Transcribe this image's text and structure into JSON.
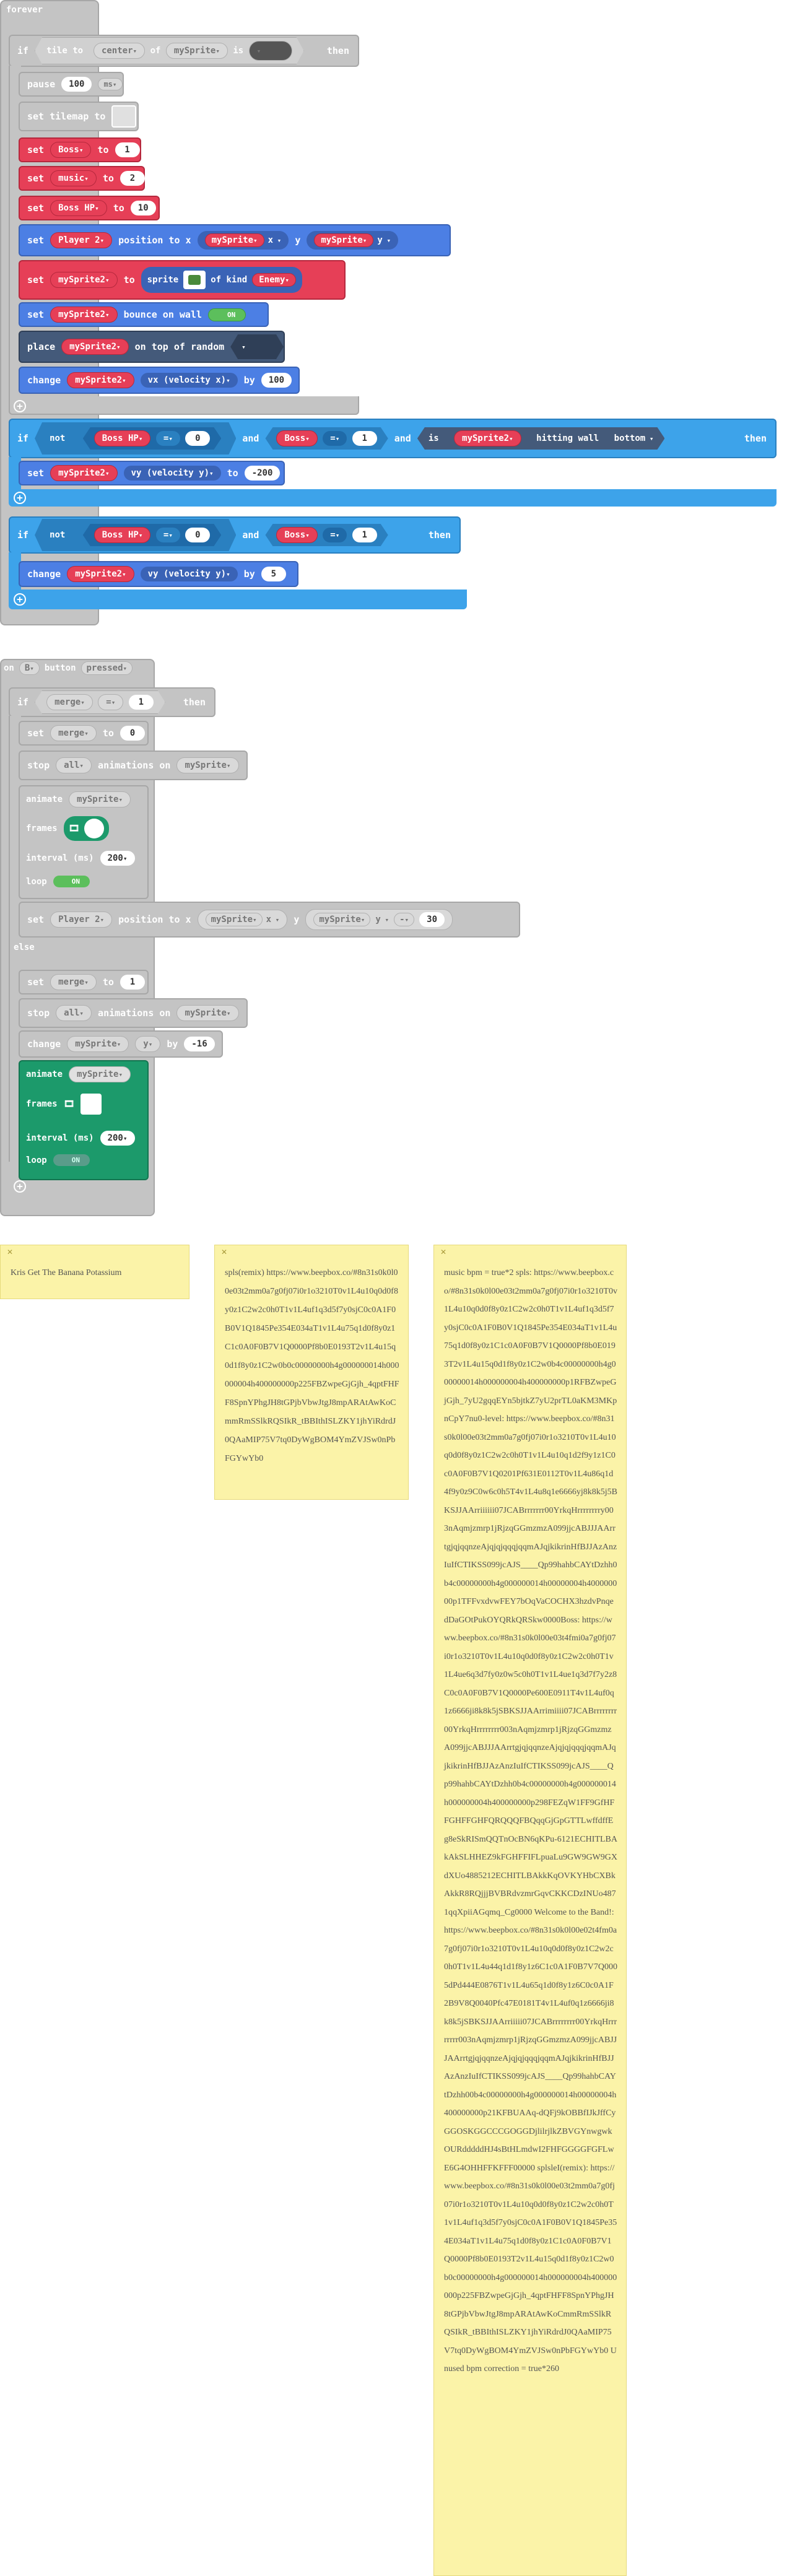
{
  "forever": {
    "label": "forever",
    "if1": {
      "if": "if",
      "tile_to": "tile to",
      "center": "center",
      "of": "of",
      "sprite": "mySprite",
      "is": "is",
      "then": "then"
    },
    "pause": {
      "label": "pause",
      "value": "100",
      "unit": "ms"
    },
    "set_tilemap": {
      "label": "set tilemap to"
    },
    "set_boss": {
      "set": "set",
      "var": "Boss",
      "to": "to",
      "value": "1"
    },
    "set_music": {
      "set": "set",
      "var": "music",
      "to": "to",
      "value": "2"
    },
    "set_bosshp": {
      "set": "set",
      "var": "Boss HP",
      "to": "to",
      "value": "10"
    },
    "set_pos": {
      "set": "set",
      "player": "Player 2",
      "mid": "position to x",
      "sprite": "mySprite",
      "x": "x",
      "y_label": "y",
      "sprite2": "mySprite",
      "y": "y"
    },
    "set_sprite2": {
      "set": "set",
      "var": "mySprite2",
      "to": "to",
      "sprite": "sprite",
      "of_kind": "of kind",
      "kind": "Enemy"
    },
    "bounce": {
      "set": "set",
      "sprite": "mySprite2",
      "label": "bounce on wall",
      "toggle": "ON"
    },
    "place": {
      "label": "place",
      "sprite": "mySprite2",
      "mid": "on top of random"
    },
    "change_vx": {
      "label": "change",
      "sprite": "mySprite2",
      "prop": "vx (velocity x)",
      "by": "by",
      "value": "100"
    },
    "if2": {
      "if": "if",
      "not": "not",
      "bosshp": "Boss HP",
      "eq": "=",
      "zero": "0",
      "and": "and",
      "boss": "Boss",
      "eq2": "=",
      "one": "1",
      "and2": "and",
      "is": "is",
      "sprite": "mySprite2",
      "hitting": "hitting wall",
      "side": "bottom",
      "then": "then"
    },
    "set_vy": {
      "set": "set",
      "sprite": "mySprite2",
      "prop": "vy (velocity y)",
      "to": "to",
      "value": "-200"
    },
    "if3": {
      "if": "if",
      "not": "not",
      "bosshp": "Boss HP",
      "eq": "=",
      "zero": "0",
      "and": "and",
      "boss": "Boss",
      "eq2": "=",
      "one": "1",
      "then": "then"
    },
    "change_vy": {
      "label": "change",
      "sprite": "mySprite2",
      "prop": "vy (velocity y)",
      "by": "by",
      "value": "5"
    }
  },
  "onbutton": {
    "on": "on",
    "btn": "B",
    "button": "button",
    "event": "pressed",
    "if": {
      "if": "if",
      "var": "merge",
      "eq": "=",
      "value": "1",
      "then": "then"
    },
    "set_merge0": {
      "set": "set",
      "var": "merge",
      "to": "to",
      "value": "0"
    },
    "stop": {
      "label": "stop",
      "which": "all",
      "mid": "animations on",
      "sprite": "mySprite"
    },
    "animate": {
      "label": "animate",
      "sprite": "mySprite",
      "frames": "frames",
      "interval": "interval (ms)",
      "interval_value": "200",
      "loop": "loop",
      "loop_value": "ON"
    },
    "set_pos": {
      "set": "set",
      "player": "Player 2",
      "mid": "position to x",
      "sprite": "mySprite",
      "x": "x",
      "y_label": "y",
      "sprite2": "mySprite",
      "y": "y",
      "op": "-",
      "value": "30"
    },
    "else": "else",
    "set_merge1": {
      "set": "set",
      "var": "merge",
      "to": "to",
      "value": "1"
    },
    "stop2": {
      "label": "stop",
      "which": "all",
      "mid": "animations on",
      "sprite": "mySprite"
    },
    "change": {
      "label": "change",
      "sprite": "mySprite",
      "prop": "y",
      "by": "by",
      "value": "-16"
    },
    "animate2": {
      "label": "animate",
      "sprite": "mySprite",
      "frames": "frames",
      "interval": "interval (ms)",
      "interval_value": "200",
      "loop": "loop",
      "loop_value": "ON"
    }
  },
  "comments": [
    {
      "text": "Kris Get The Banana Potassium"
    },
    {
      "text": "spls(remix) https://www.beepbox.co/#8n31s0k0l00e03t2mm0a7g0fj07i0r1o3210T0v1L4u10q0d0f8y0z1C2w2c0h0T1v1L4uf1q3d5f7y0sjC0c0A1F0B0V1Q1845Pe354E034aT1v1L4u75q1d0f8y0z1C1c0A0F0B7V1Q0000Pf8b0E0193T2v1L4u15q0d1f8y0z1C2w0b0c00000000h4g000000014h000000004h400000000p225FBZwpeGjGjh_4qptFHFF8SpnYPhgJH8tGPjbVbwJtgJ8mpARAtAwKoCmmRmSSlkRQSIkR_tBBIthISLZKY1jhYiRdrdJ0QAaMIP75V7tq0DyWgBOM4YmZVJSw0nPbFGYwYb0"
    },
    {
      "text": "music bpm = true*2 spls: https://www.beepbox.co/#8n31s0k0l00e03t2mm0a7g0fj07i0r1o3210T0v1L4u10q0d0f8y0z1C2w2c0h0T1v1L4uf1q3d5f7y0sjC0c0A1F0B0V1Q1845Pe354E034aT1v1L4u75q1d0f8y0z1C1c0A0F0B7V1Q0000Pf8b0E0193T2v1L4u15q0d1f8y0z1C2w0b4c00000000h4g000000014h000000004h400000000p1RFBZwpeGjGjh_7yU2gqqEYn5bjtkZ7yU2prTL0aKM3MKpnCpY7nu0-level: https://www.beepbox.co/#8n31s0k0l00e03t2mm0a7g0fj07i0r1o3210T0v1L4u10q0d0f8y0z1C2w2c0h0T1v1L4u10q1d2f9y1z1C0c0A0F0B7V1Q0201Pf631E0112T0v1L4u86q1d4f9y0z9C0w6c0h5T4v1L4u8q1e6666yj8k8k5j5BKSJJAArriiiiii07JCABrrrrrrr00YrkqHrrrrrrrry003nAqmjzmrp1jRjzqGGmzmzA099jjcABJJJAArrtgjqjqqnzeAjqjqjqqqjqqmAJqjkikrinHfBJJAzAnzIuIfCTIKSS099jcAJS____Qp99hahbCAYtDzhh0b4c00000000h4g000000014h00000004h400000000p1TFFvxdvwFEY7bOqVaCOCHX3hzdvPnqedDaGOtPukOYQRkQRSkw0000Boss: https://www.beepbox.co/#8n31s0k0l00e03t4fmi0a7g0fj07i0r1o3210T0v1L4u10q0d0f8y0z1C2w2c0h0T1v1L4ue6q3d7fy0z0w5c0h0T1v1L4ue1q3d7f7y2z8C0c0A0F0B7V1Q0000Pe600E0911T4v1L4uf0q1z6666ji8k8k5jSBKSJJAArrimiiii07JCABrrrrrrrr00YrkqHrrrrrrrr003nAqmjzmrp1jRjzqGGmzmzA099jjcABJJJAArrtgjqjqqnzeAjqjqjqqqjqqmAJqjkikrinHfBJJAzAnzIuIfCTIKSS099jcAJS____Qp99hahbCAYtDzhh0b4c00000000h4g000000014h000000004h400000000p298FEZqW1FF9GfHFFGHFFGHFQRQQQFBQqqGjGpGTTLwffdffEg8eSkRISmQQTnOcBN6qKPu-6121ECHITLBAkAkSLHHEZ9kFGHFFIFLpuaLu9GW9GW9GXdXUo4885212ECHITLBAkkKqOVKYHbCXBkAkkR8RQjjjBVBRdvzmrGqvCKKCDzINUo4871qqXpiiAGqmq_Cg0000 Welcome to the Band!: https://www.beepbox.co/#8n31s0k0l00e02t4fm0a7g0fj07i0r1o3210T0v1L4u10q0d0f8y0z1C2w2c0h0T1v1L4u44q1d1f8y1z6C1c0A1F0B7V7Q0005dPd444E0876T1v1L4u65q1d0f8y1z6C0c0A1F2B9V8Q0040Pfc47E0181T4v1L4uf0q1z6666ji8k8k5jSBKSJJAArriiiii07JCABrrrrrrrr00YrkqHrrrrrrrr003nAqmjzmrp1jRjzqGGmzmzA099jjcABJJJAArrtgjqjqqnzeAjqjqjqqqjqqmAJqjkikrinHfBJJAzAnzIuIfCTIKSS099jcAJS____Qp99hahbCAYtDzhh00b4c00000000h4g000000014h00000004h400000000p21KFBUAAq-dQFj9kOBBfIJkJffCyGGOSKGGCCCGOGGDjlilrjlkZBVGYnwgwkOURdddddHJ4sBtHLmdwI2FHFGGGGFGFLwE6G4OHHFFKFFF00000 splsleI(remix): https://www.beepbox.co/#8n31s0k0l00e03t2mm0a7g0fj07i0r1o3210T0v1L4u10q0d0f8y0z1C2w2c0h0T1v1L4uf1q3d5f7y0sjC0c0A1F0B0V1Q1845Pe354E034aT1v1L4u75q1d0f8y0z1C1c0A0F0B7V1Q0000Pf8b0E0193T2v1L4u15q0d1f8y0z1C2w0b0c00000000h4g000000014h000000004h400000000p225FBZwpeGjGjh_4qptFHFF8SpnYPhgJH8tGPjbVbwJtgJ8mpARAtAwKoCmmRmSSlkRQSIkR_tBBIthISLZKY1jhYiRdrdJ0QAaMIP75V7tq0DyWgBOM4YmZVJSw0nPbFGYwYb0 Unused bpm correction = true*260"
    }
  ]
}
